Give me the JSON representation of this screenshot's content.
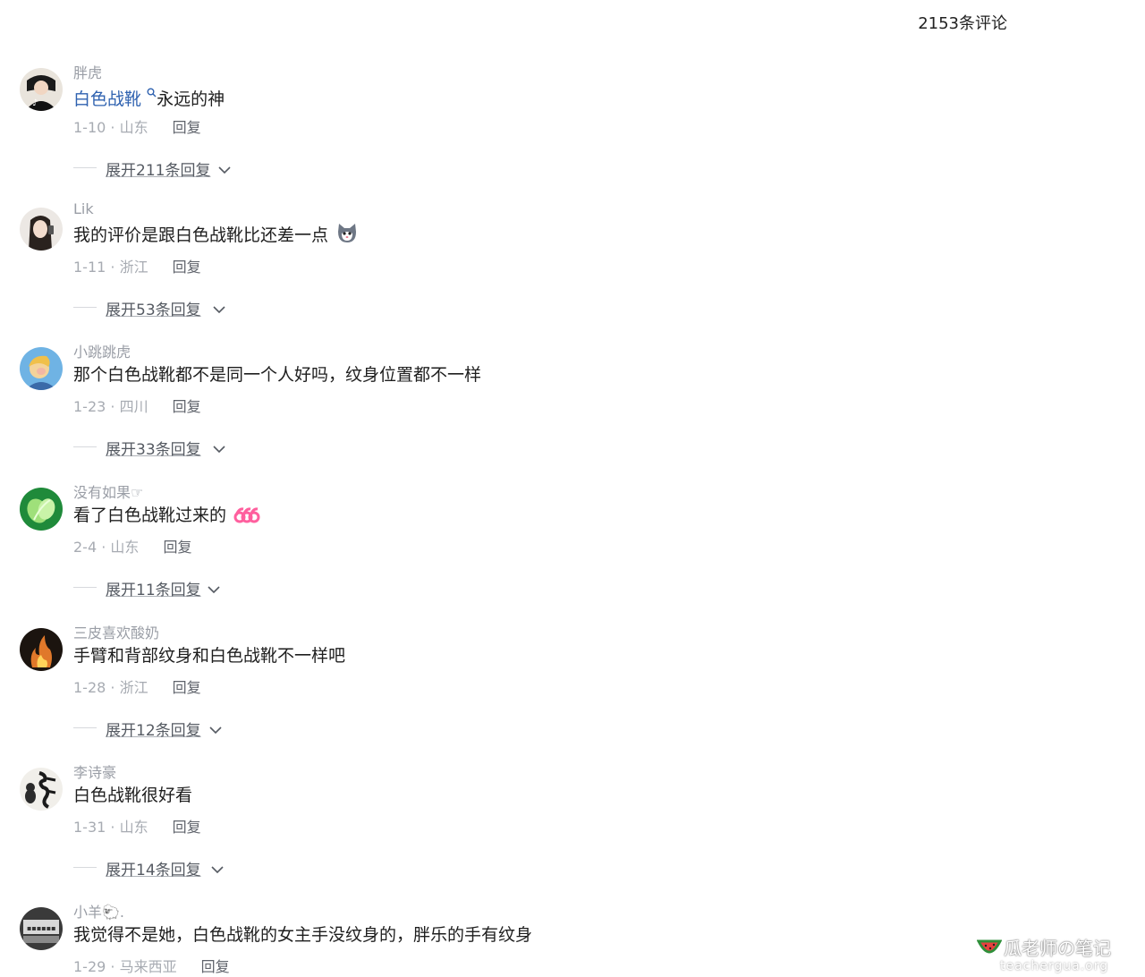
{
  "header": {
    "comment_count": "2153条评论"
  },
  "reply_label": "回复",
  "comments": [
    {
      "username": "胖虎",
      "text_highlight": "白色战靴",
      "text": "永远的神",
      "date_location": "1-10 · 山东",
      "expand": "展开211条回复",
      "avatar_icon": "person-photo-avatar"
    },
    {
      "username": "Lik",
      "text": "我的评价是跟白色战靴比还差一点",
      "emoji": "cat-face-emoji",
      "date_location": "1-11 · 浙江",
      "expand": "展开53条回复",
      "avatar_icon": "person-photo-avatar"
    },
    {
      "username": "小跳跳虎",
      "text": "那个白色战靴都不是同一个人好吗，纹身位置都不一样",
      "date_location": "1-23 · 四川",
      "expand": "展开33条回复",
      "avatar_icon": "blonde-person-avatar"
    },
    {
      "username": "没有如果☞",
      "text": "看了白色战靴过来的",
      "emoji": "666-emoji",
      "date_location": "2-4 · 山东",
      "expand": "展开11条回复",
      "avatar_icon": "green-cabbage-avatar"
    },
    {
      "username": "三皮喜欢酸奶",
      "text": "手臂和背部纹身和白色战靴不一样吧",
      "date_location": "1-28 · 浙江",
      "expand": "展开12条回复",
      "avatar_icon": "fire-avatar"
    },
    {
      "username": "李诗豪",
      "text": "白色战靴很好看",
      "date_location": "1-31 · 山东",
      "expand": "展开14条回复",
      "avatar_icon": "calligraphy-avatar"
    },
    {
      "username": "小羊🐑.",
      "text": "我觉得不是她，白色战靴的女主手没纹身的，胖乐的手有纹身",
      "date_location": "1-29 · 马来西亚",
      "avatar_icon": "gray-photo-avatar"
    }
  ],
  "watermark": {
    "title": "瓜老师の笔记",
    "url": "teachergua.org"
  }
}
